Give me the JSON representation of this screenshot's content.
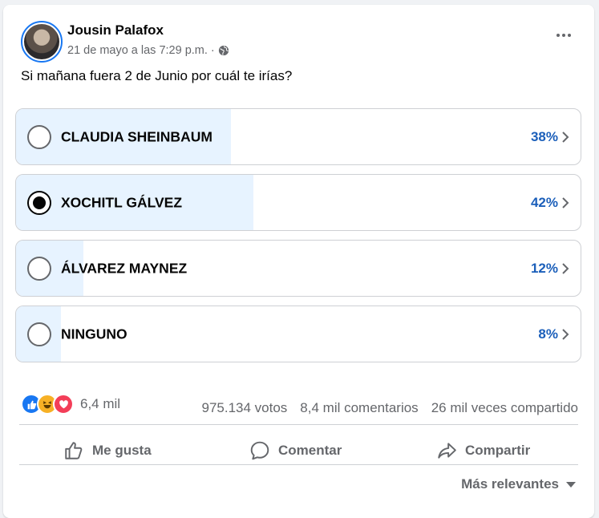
{
  "post": {
    "author": "Jousin Palafox",
    "timestamp": "21 de mayo a las 7:29 p.m. ·",
    "privacy_icon": "globe-icon",
    "text": "Si mañana fuera 2 de Junio por cuál te irías?"
  },
  "poll": {
    "options": [
      {
        "label": "CLAUDIA SHEINBAUM",
        "percent_text": "38%",
        "percent": 38,
        "selected": false
      },
      {
        "label": "XOCHITL GÁLVEZ",
        "percent_text": "42%",
        "percent": 42,
        "selected": true
      },
      {
        "label": "ÁLVAREZ MAYNEZ",
        "percent_text": "12%",
        "percent": 12,
        "selected": false
      },
      {
        "label": "NINGUNO",
        "percent_text": "8%",
        "percent": 8,
        "selected": false
      }
    ],
    "fill_color": "#e7f3ff",
    "percent_color": "#1b5fba"
  },
  "engagement": {
    "reaction_icons": [
      "like-icon",
      "haha-icon",
      "love-icon"
    ],
    "reaction_count": "6,4 mil",
    "votes": "975.134 votos",
    "comments": "8,4 mil comentarios",
    "shares": "26 mil veces compartido"
  },
  "actions": {
    "like": "Me gusta",
    "comment": "Comentar",
    "share": "Compartir"
  },
  "sort": {
    "label": "Más relevantes"
  }
}
